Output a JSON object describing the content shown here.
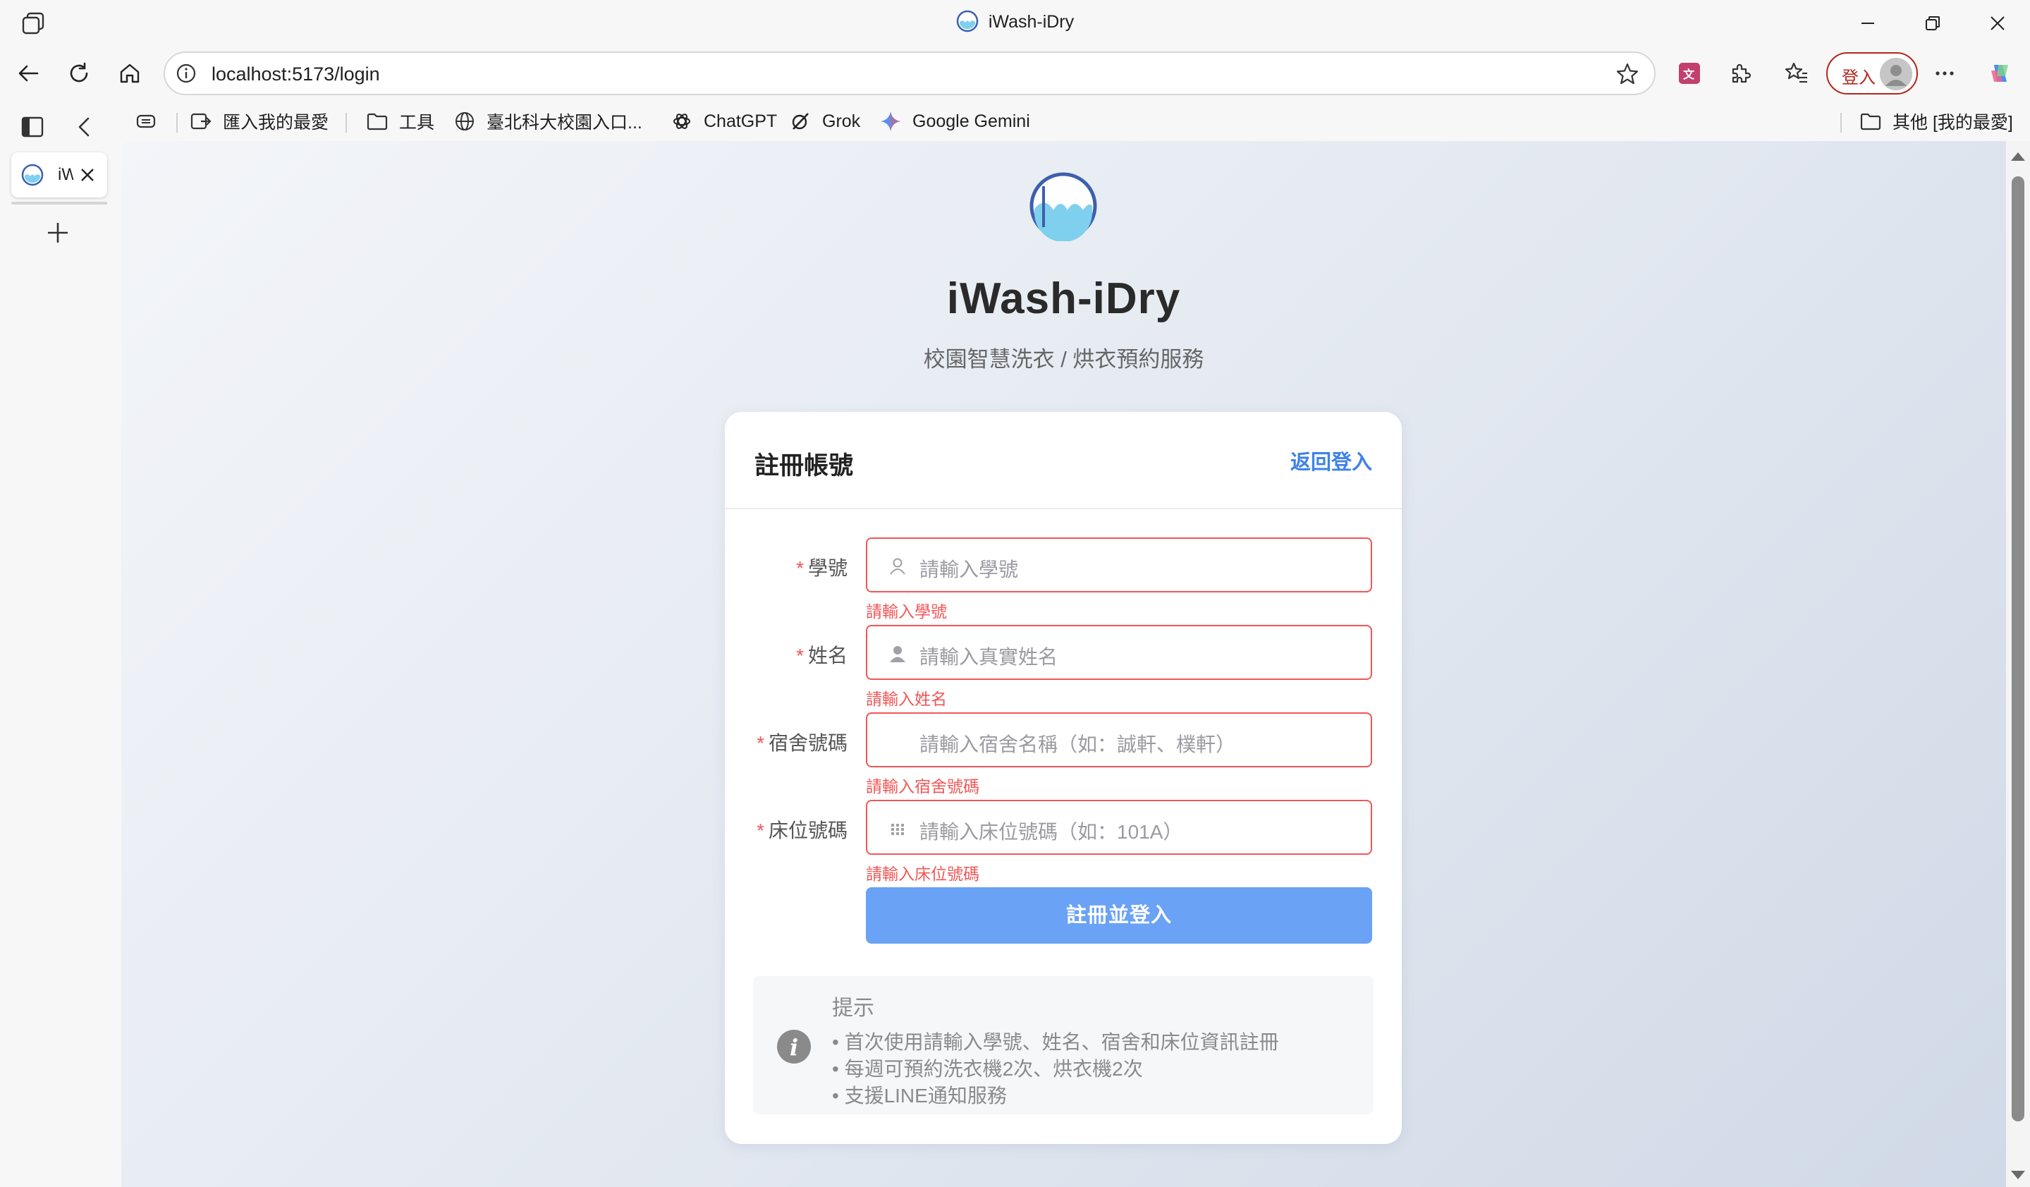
{
  "window": {
    "title": "iWash-iDry",
    "buttons": {
      "minimize": "minimize-icon",
      "restore": "restore-icon",
      "close": "close-icon"
    }
  },
  "toolbar": {
    "url": "localhost:5173/login",
    "signin_label": "登入"
  },
  "favorites": [
    {
      "label": "匯入我的最愛",
      "icon": "import-favorites-icon"
    },
    {
      "label": "工具",
      "icon": "folder-icon"
    },
    {
      "label": "臺北科大校園入口...",
      "icon": "globe-icon"
    },
    {
      "label": "ChatGPT",
      "icon": "chatgpt-icon"
    },
    {
      "label": "Grok",
      "icon": "grok-icon"
    },
    {
      "label": "Google Gemini",
      "icon": "gemini-icon"
    }
  ],
  "favorites_other": "其他 [我的最愛]",
  "vertical_tab": {
    "title": "iWash-iDry"
  },
  "page": {
    "app_title": "iWash-iDry",
    "app_subtitle": "校園智慧洗衣 / 烘衣預約服務",
    "card_title": "註冊帳號",
    "back_link": "返回登入",
    "fields": [
      {
        "label": "學號",
        "placeholder": "請輸入學號",
        "error": "請輸入學號",
        "icon": "user-outline-icon"
      },
      {
        "label": "姓名",
        "placeholder": "請輸入真實姓名",
        "error": "請輸入姓名",
        "icon": "user-filled-icon"
      },
      {
        "label": "宿舍號碼",
        "placeholder": "請輸入宿舍名稱（如：誠軒、樸軒）",
        "error": "請輸入宿舍號碼",
        "icon": ""
      },
      {
        "label": "床位號碼",
        "placeholder": "請輸入床位號碼（如：101A）",
        "error": "請輸入床位號碼",
        "icon": "grid-icon"
      }
    ],
    "submit_label": "註冊並登入",
    "tip": {
      "title": "提示",
      "lines": [
        "• 首次使用請輸入學號、姓名、宿舍和床位資訊註冊",
        "• 每週可預約洗衣機2次、烘衣機2次",
        "• 支援LINE通知服務"
      ]
    }
  },
  "colors": {
    "accent": "#3f82e8",
    "button": "#6aa2f5",
    "error": "#f25656",
    "signin": "#b3261e"
  }
}
